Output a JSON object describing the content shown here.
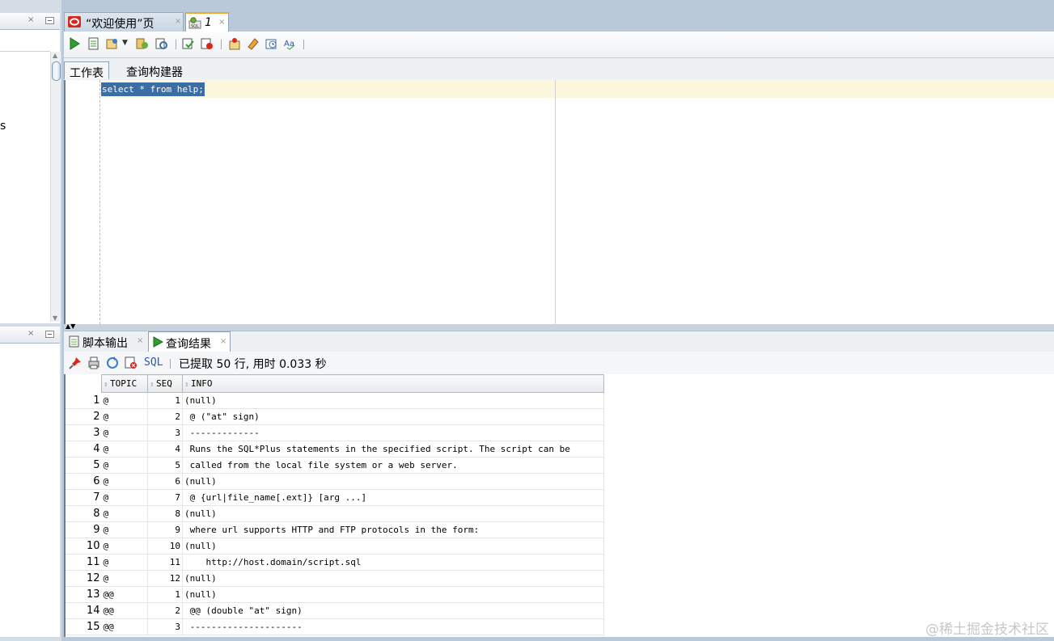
{
  "left_panel": {
    "partial_text": "s"
  },
  "editor_tabs": [
    {
      "label": "“欢迎使用”页"
    },
    {
      "label": "1"
    }
  ],
  "sub_tabs": [
    {
      "label": "工作表"
    },
    {
      "label": "查询构建器"
    }
  ],
  "editor": {
    "sql": "select * from help;"
  },
  "result_tabs": [
    {
      "label": "脚本输出"
    },
    {
      "label": "查询结果"
    }
  ],
  "results_toolbar": {
    "sql_link": "SQL",
    "status": "已提取 50 行, 用时 0.033 秒"
  },
  "grid": {
    "columns": [
      "TOPIC",
      "SEQ",
      "INFO"
    ],
    "rows": [
      [
        "1",
        "@",
        "1",
        "(null)"
      ],
      [
        "2",
        "@",
        "2",
        " @ (\"at\" sign)"
      ],
      [
        "3",
        "@",
        "3",
        " -------------"
      ],
      [
        "4",
        "@",
        "4",
        " Runs the SQL*Plus statements in the specified script. The script can be"
      ],
      [
        "5",
        "@",
        "5",
        " called from the local file system or a web server."
      ],
      [
        "6",
        "@",
        "6",
        "(null)"
      ],
      [
        "7",
        "@",
        "7",
        " @ {url|file_name[.ext]} [arg ...]"
      ],
      [
        "8",
        "@",
        "8",
        "(null)"
      ],
      [
        "9",
        "@",
        "9",
        " where url supports HTTP and FTP protocols in the form:"
      ],
      [
        "10",
        "@",
        "10",
        "(null)"
      ],
      [
        "11",
        "@",
        "11",
        "    http://host.domain/script.sql"
      ],
      [
        "12",
        "@",
        "12",
        "(null)"
      ],
      [
        "13",
        "@@",
        "1",
        "(null)"
      ],
      [
        "14",
        "@@",
        "2",
        " @@ (double \"at\" sign)"
      ],
      [
        "15",
        "@@",
        "3",
        " ---------------------"
      ]
    ]
  },
  "watermark": "@稀土掘金技术社区",
  "colors": {
    "selection": "#3a6ea5",
    "current_line": "#fbf6dc",
    "tab_accent": "#f0a830"
  }
}
